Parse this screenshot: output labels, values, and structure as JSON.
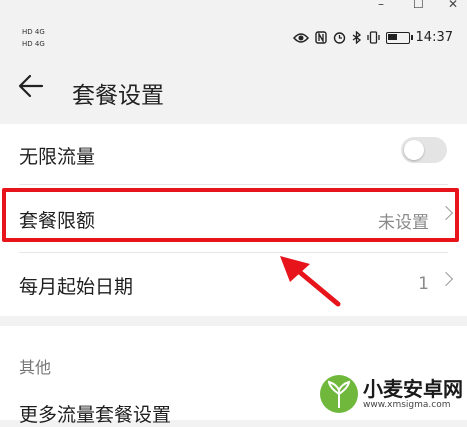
{
  "window_controls": {
    "minimize": "–",
    "maximize": "☐",
    "close": "✕"
  },
  "status_bar": {
    "signal_1": "HD 4G",
    "signal_2": "HD 4G",
    "time": "14:37",
    "battery_level": 0.55,
    "icons": [
      "eye-icon",
      "nfc-icon",
      "alarm-icon",
      "bluetooth-icon",
      "vibrate-icon",
      "battery-icon"
    ]
  },
  "header": {
    "back_icon": "arrow-left-icon",
    "title": "套餐设置"
  },
  "settings": {
    "unlimited": {
      "label": "无限流量",
      "enabled": false
    },
    "package_limit": {
      "label": "套餐限额",
      "value": "未设置"
    },
    "start_date": {
      "label": "每月起始日期",
      "value": "1"
    }
  },
  "other_section": {
    "title": "其他",
    "more_packages": {
      "label": "更多流量套餐设置"
    }
  },
  "watermark": {
    "name": "小麦安卓网",
    "url": "www.xmsigma.com"
  },
  "colors": {
    "highlight": "#e8141c",
    "background": "#f2f2f2"
  }
}
